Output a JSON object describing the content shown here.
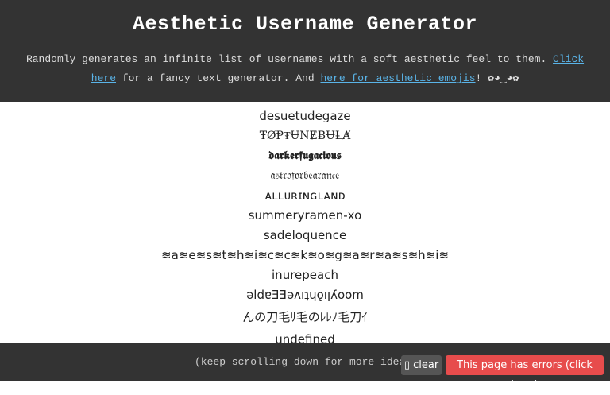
{
  "header": {
    "title": "Aesthetic Username Generator",
    "desc_prefix": "Randomly generates an infinite list of usernames with a soft aesthetic feel to them. ",
    "link_click_here": "Click here",
    "desc_middle": " for a fancy text generator. And ",
    "link_emojis": "here for aesthetic emojis",
    "desc_suffix": "! ✿◕‿◕✿"
  },
  "usernames": [
    "desuetudegaze",
    "ŦØⱣ₮ɄNɆɃɄⱠȺ",
    "𝖉𝖆𝖗𝖐𝖊𝖗𝖋𝖚𝖌𝖆𝖈𝖎𝖔𝖚𝖘",
    "𝔞𝔰𝔱𝔯𝔬𝔣𝔬𝔯𝔟𝔢𝔞𝔯𝔞𝔫𝔠𝔢",
    "ᴀʟʟᴜʀɪɴɢʟᴀɴᴅ",
    "summeryramen-xo",
    "sadeloquence",
    "≋a≋e≋s≋t≋h≋i≋c≋c≋k≋o≋g≋a≋r≋a≋s≋h≋i≋",
    "inurepeach",
    "ǝldɐƎƎǝʌıʇɥǫıןʎoom",
    "んの刀毛ﾘ毛のﾚﾚﾉ毛刀ｲ",
    "undefined"
  ],
  "footer": {
    "hint": "(keep scrolling down for more ideas)",
    "clear_label": "clear",
    "errors_label": "This page has errors (click here)"
  },
  "colors": {
    "header_bg": "#333333",
    "link": "#5ab4e8",
    "error_button": "#e74c4c",
    "clear_button": "#555555"
  }
}
